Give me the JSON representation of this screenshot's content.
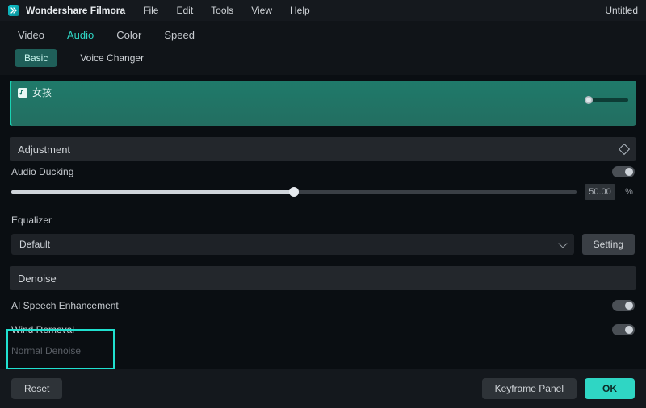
{
  "app": {
    "title": "Wondershare Filmora",
    "doc_title": "Untitled"
  },
  "menu": [
    "File",
    "Edit",
    "Tools",
    "View",
    "Help"
  ],
  "tabs": [
    "Video",
    "Audio",
    "Color",
    "Speed"
  ],
  "active_tab": "Audio",
  "subtabs": [
    "Basic",
    "Voice Changer"
  ],
  "active_subtab": "Basic",
  "clip": {
    "name": "女孩"
  },
  "sections": {
    "adjustment": {
      "title": "Adjustment"
    },
    "audio_ducking": {
      "label": "Audio Ducking",
      "value": "50.00",
      "pct": "%"
    },
    "equalizer": {
      "label": "Equalizer",
      "selected": "Default",
      "setting_btn": "Setting"
    },
    "denoise": {
      "title": "Denoise",
      "items": [
        {
          "label": "AI Speech Enhancement"
        },
        {
          "label": "Wind Removal"
        }
      ],
      "cutoff": "Normal Denoise"
    }
  },
  "footer": {
    "reset": "Reset",
    "keyframe": "Keyframe Panel",
    "ok": "OK"
  }
}
